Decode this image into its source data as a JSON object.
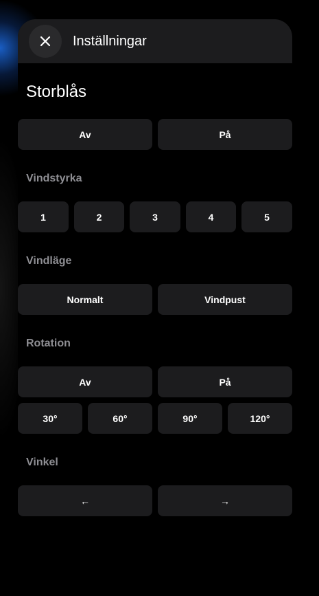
{
  "header": {
    "title": "Inställningar",
    "close_icon": "close-icon"
  },
  "section": {
    "title": "Storblås"
  },
  "power": {
    "off": "Av",
    "on": "På"
  },
  "wind_strength": {
    "label": "Vindstyrka",
    "options": [
      "1",
      "2",
      "3",
      "4",
      "5"
    ]
  },
  "wind_mode": {
    "label": "Vindläge",
    "options": [
      "Normalt",
      "Vindpust"
    ]
  },
  "rotation": {
    "label": "Rotation",
    "off": "Av",
    "on": "På",
    "angles": [
      "30°",
      "60°",
      "90°",
      "120°"
    ]
  },
  "angle": {
    "label": "Vinkel",
    "left": "←",
    "right": "→"
  },
  "colors": {
    "background": "#000000",
    "surface": "#1c1c1e",
    "muted_text": "#8e8e93",
    "accent_glow": "#1e6ee6"
  }
}
